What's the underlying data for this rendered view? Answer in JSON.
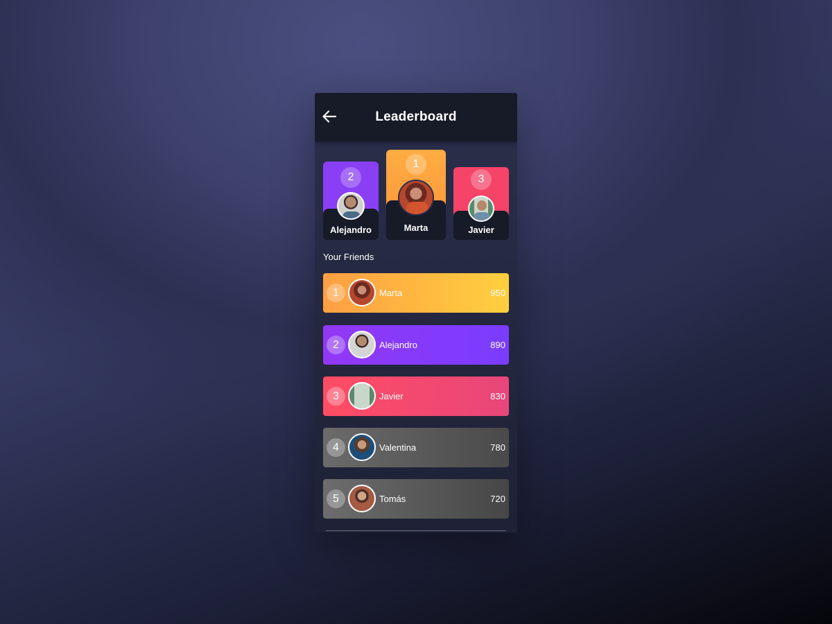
{
  "header": {
    "title": "Leaderboard",
    "back_icon": "arrow-left-icon"
  },
  "podium": [
    {
      "rank": "2",
      "name": "Alejandro",
      "color_top": "#8e3bf6",
      "color_bottom": "#8a3ff5"
    },
    {
      "rank": "1",
      "name": "Marta",
      "color_top": "#ffab40",
      "color_bottom": "#ff9b3c"
    },
    {
      "rank": "3",
      "name": "Javier",
      "color_top": "#ff4d6a",
      "color_bottom": "#f54468"
    }
  ],
  "friends": {
    "label": "Your Friends",
    "items": [
      {
        "rank": "1",
        "name": "Marta",
        "score": "950",
        "gradient": [
          "#ff9f43",
          "#ffd23f"
        ]
      },
      {
        "rank": "2",
        "name": "Alejandro",
        "score": "890",
        "gradient": [
          "#9238f5",
          "#7a3cff"
        ]
      },
      {
        "rank": "3",
        "name": "Javier",
        "score": "830",
        "gradient": [
          "#ff4c64",
          "#e8467a"
        ]
      },
      {
        "rank": "4",
        "name": "Valentina",
        "score": "780",
        "gradient": [
          "#6b6b6b",
          "#4a4a4a"
        ]
      },
      {
        "rank": "5",
        "name": "Tomás",
        "score": "720",
        "gradient": [
          "#6d6d6d",
          "#464646"
        ]
      }
    ]
  }
}
